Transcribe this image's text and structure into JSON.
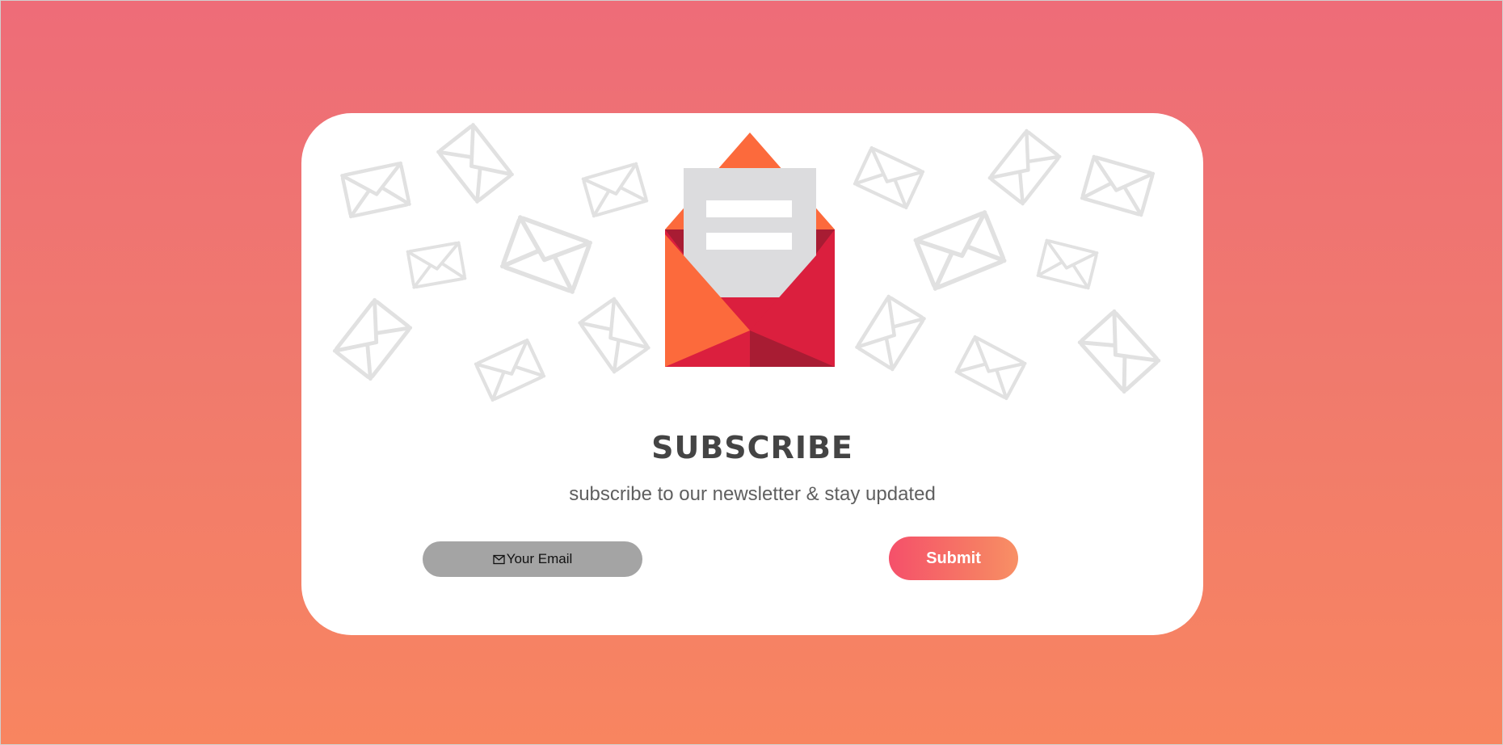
{
  "card": {
    "title": "SUBSCRIBE",
    "subtitle": "subscribe to our newsletter & stay updated"
  },
  "form": {
    "email_placeholder": "Your Email",
    "email_icon": "envelope-icon",
    "submit_label": "Submit"
  },
  "illustration": {
    "icon": "open-envelope-letter-icon",
    "pattern_icon": "envelope-outline-icon"
  },
  "colors": {
    "background_top": "#ee6c78",
    "background_bottom": "#f88560",
    "card": "#ffffff",
    "title": "#444444",
    "subtitle": "#5f5f5f",
    "input_pill": "#a4a4a4",
    "submit_gradient_start": "#f5506a",
    "submit_gradient_end": "#f89065",
    "envelope_orange": "#fc6a3c",
    "envelope_red": "#db1f3e",
    "envelope_dark_red": "#a81c33",
    "letter_gray": "#dcdcde"
  }
}
